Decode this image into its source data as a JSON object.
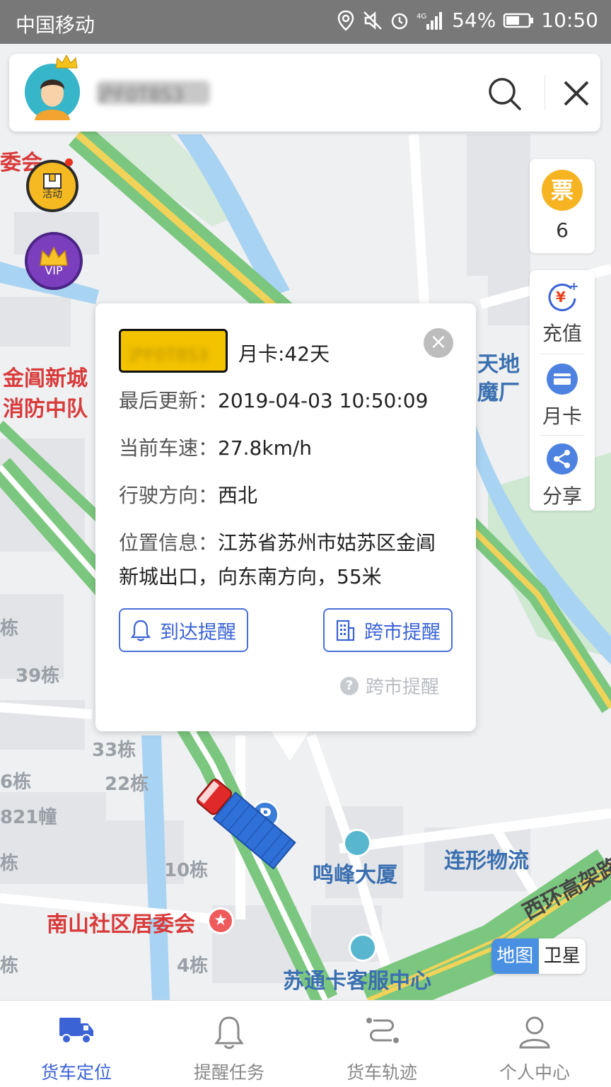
{
  "status_bar": {
    "carrier": "中国移动",
    "battery": "54%",
    "time": "10:50"
  },
  "search": {
    "plate_masked": "沪F0T8S3"
  },
  "floating_left": {
    "activity_label": "活动",
    "vip_label": "VIP"
  },
  "floating_right": {
    "ticket_icon_text": "票",
    "ticket_count": "6",
    "actions": [
      {
        "label": "充值",
        "icon": "recharge-icon"
      },
      {
        "label": "月卡",
        "icon": "card-icon"
      },
      {
        "label": "分享",
        "icon": "share-icon"
      }
    ]
  },
  "popup": {
    "plate": "沪F0T8S3",
    "month_card": "月卡:42天",
    "last_update_key": "最后更新：",
    "last_update_val": "2019-04-03 10:50:09",
    "speed_key": "当前车速：",
    "speed_val": "27.8km/h",
    "direction_key": "行驶方向：",
    "direction_val": "西北",
    "location_key": "位置信息：",
    "location_val": "江苏省苏州市姑苏区金阊新城出口，向东南方向，55米",
    "arrive_btn": "到达提醒",
    "cross_btn": "跨市提醒",
    "help_link": "跨市提醒"
  },
  "map": {
    "labels": {
      "weihui": "委会",
      "fire_1": "金阊新城",
      "fire_2": "消防中队",
      "tiandi_1": "天地",
      "tiandi_2": "魔厂",
      "b39": "39栋",
      "b33": "33栋",
      "b6": "6栋",
      "b22": "22栋",
      "b821": "821幢",
      "b10": "10栋",
      "b4": "4栋",
      "mingfeng": "鸣峰大厦",
      "lianxing": "连形物流",
      "nanshan": "南山社区居委会",
      "sutong": "苏通卡客服中心",
      "xihuan": "西环高架路",
      "dong1": "栋",
      "dong2": "栋",
      "dong3": "栋",
      "parking": "P"
    },
    "toggle_map": "地图",
    "toggle_sat": "卫星"
  },
  "nav": {
    "tabs": [
      {
        "label": "货车定位",
        "active": true
      },
      {
        "label": "提醒任务",
        "active": false
      },
      {
        "label": "货车轨迹",
        "active": false
      },
      {
        "label": "个人中心",
        "active": false
      }
    ]
  },
  "colors": {
    "accent": "#3b63d6",
    "plate_yellow": "#f3c300",
    "ticket_orange": "#f7b422",
    "vip_purple": "#7b3fbe",
    "map_blue_toggle": "#4a90e2"
  }
}
